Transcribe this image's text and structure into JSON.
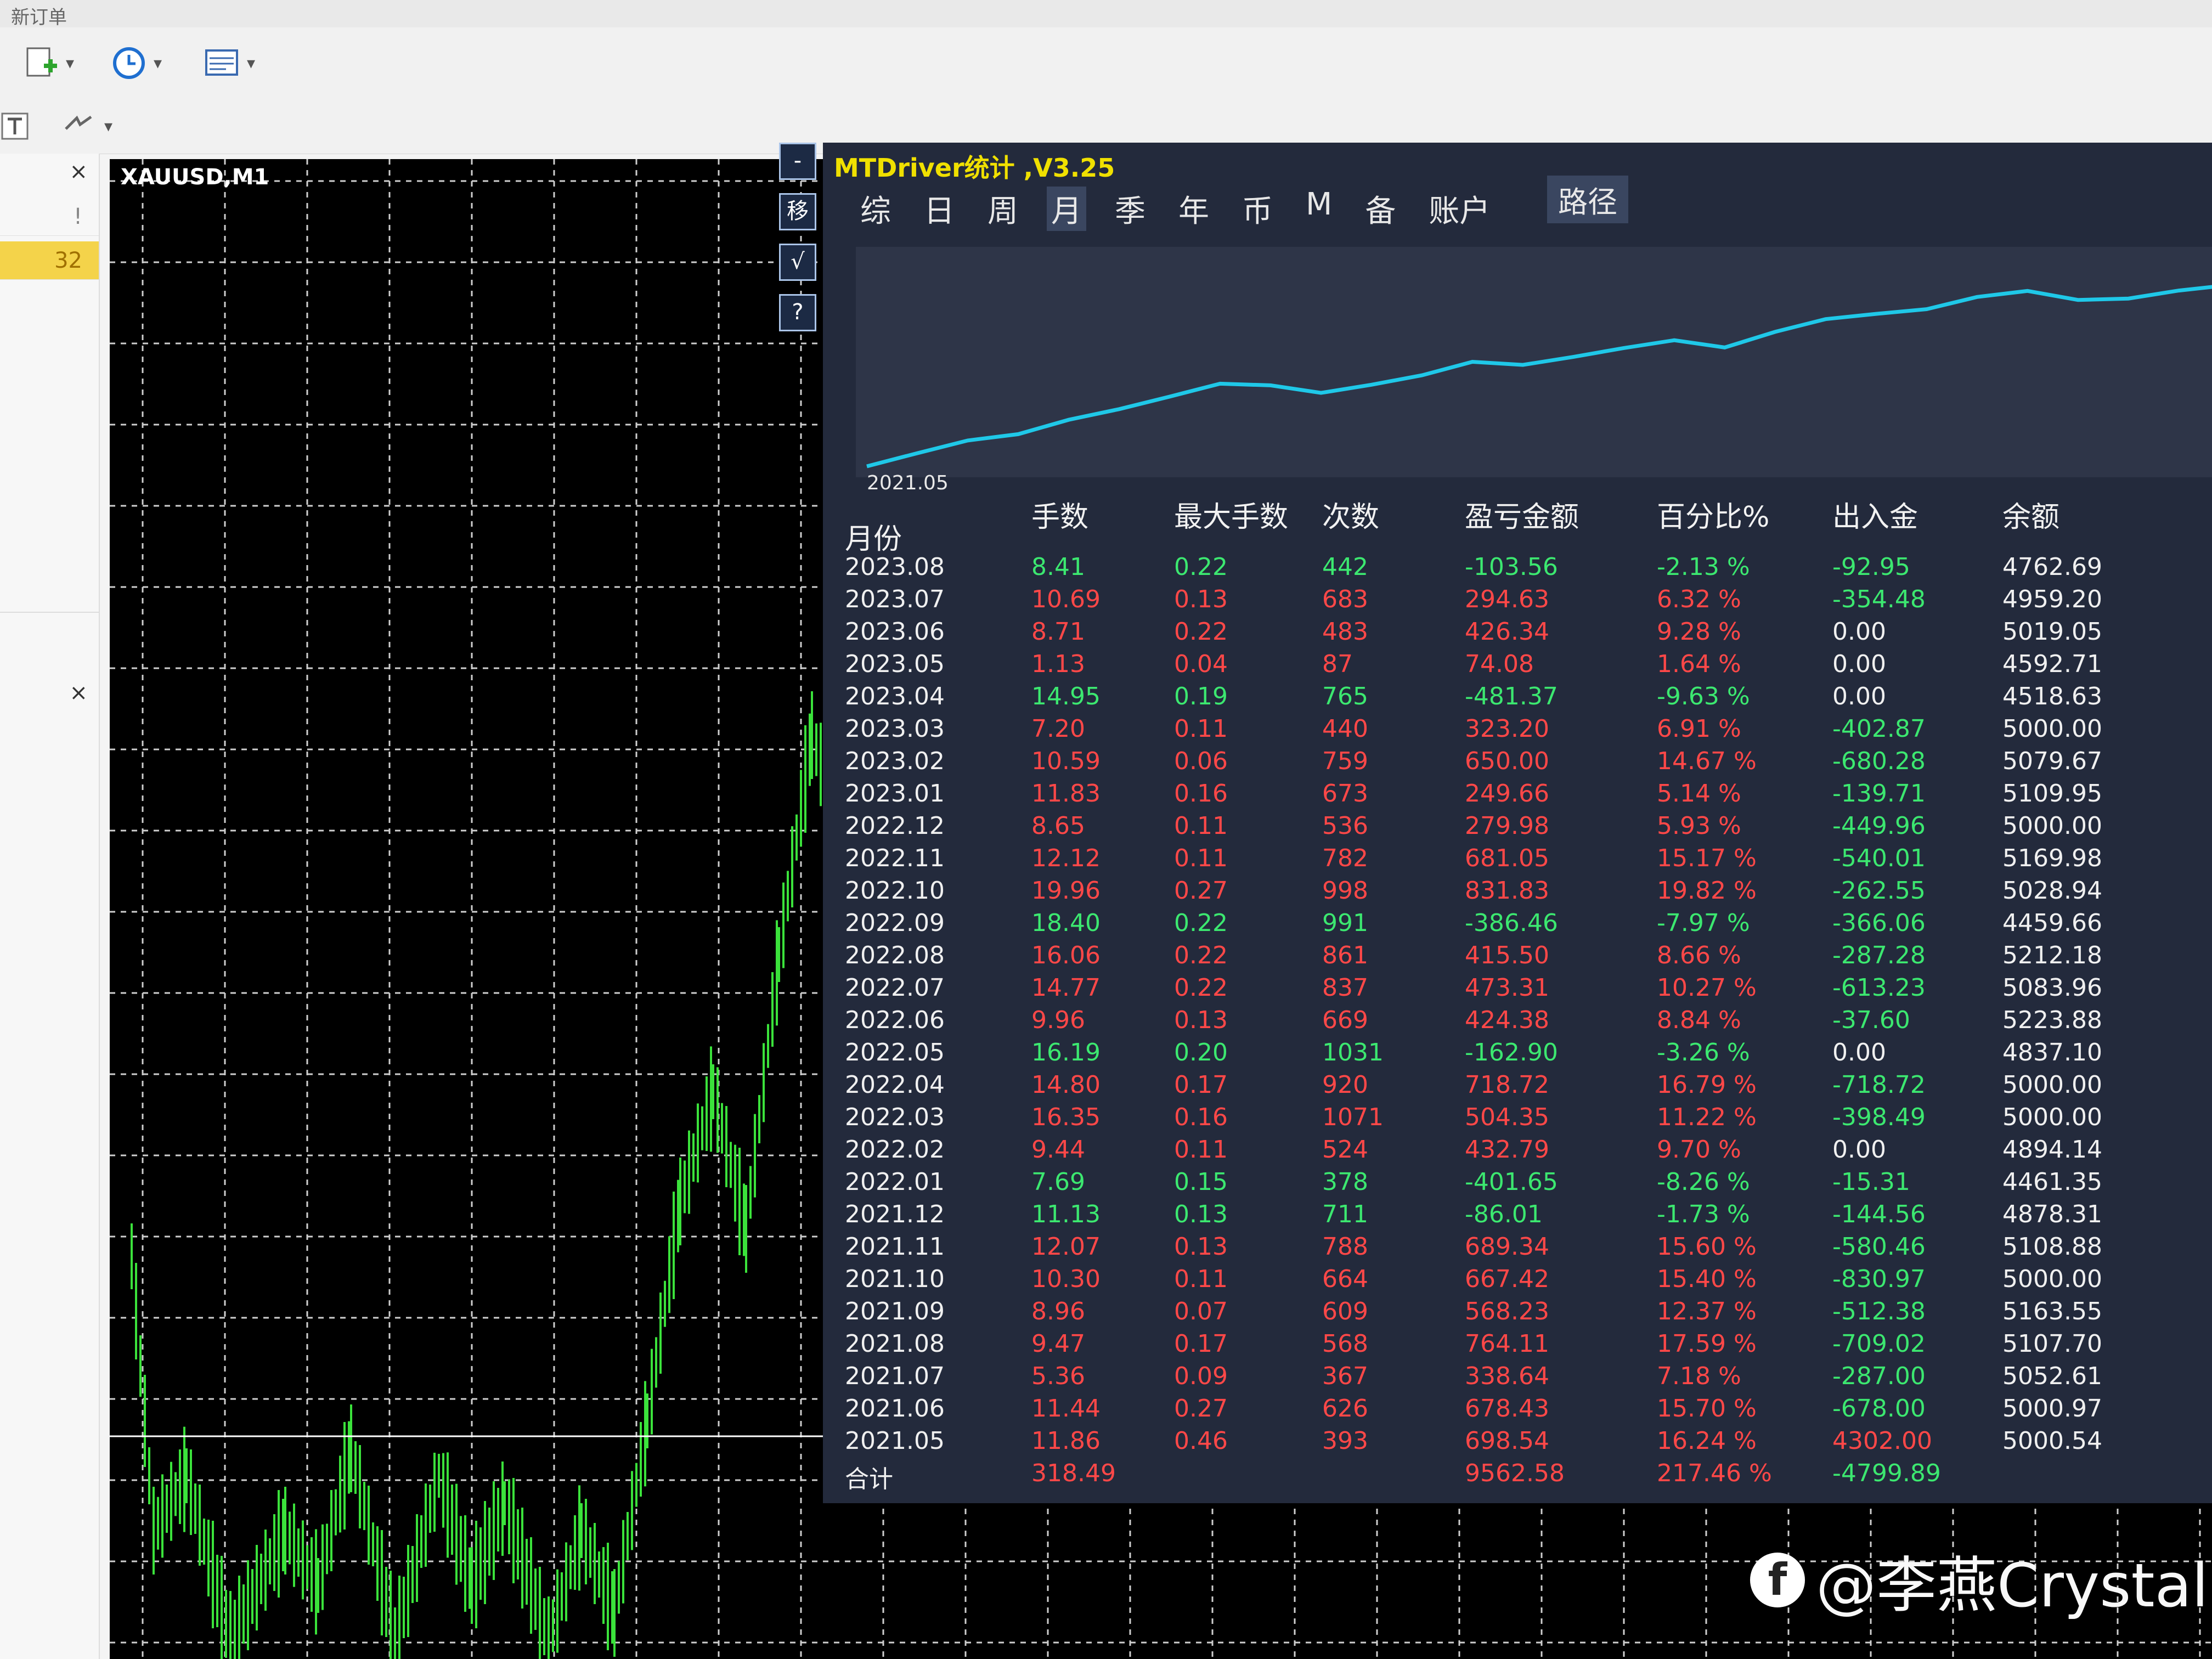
{
  "toolbar": {
    "top_label": "新订单"
  },
  "left_panel": {
    "rows": [
      "!",
      "32"
    ]
  },
  "chart": {
    "symbol_label": "XAUUSD,M1"
  },
  "side_buttons": [
    "-",
    "移",
    "√",
    "?"
  ],
  "panel": {
    "title": "MTDriver统计 ,V3.25",
    "tabs": [
      "综",
      "日",
      "周",
      "月",
      "季",
      "年",
      "币",
      "M",
      "备",
      "账户"
    ],
    "active_tab": "月",
    "path_label": "路径",
    "graph_start_label": "2021.05",
    "columns": {
      "month": "月份",
      "lots": "手数",
      "max_lots": "最大手数",
      "count": "次数",
      "pnl": "盈亏金额",
      "pct": "百分比%",
      "io": "出入金",
      "balance": "余额"
    },
    "rows": [
      {
        "month": "2023.08",
        "lots": "8.41",
        "max_lots": "0.22",
        "count": "442",
        "pnl": "-103.56",
        "pct": "-2.13 %",
        "io": "-92.95",
        "balance": "4762.69"
      },
      {
        "month": "2023.07",
        "lots": "10.69",
        "max_lots": "0.13",
        "count": "683",
        "pnl": "294.63",
        "pct": "6.32 %",
        "io": "-354.48",
        "balance": "4959.20"
      },
      {
        "month": "2023.06",
        "lots": "8.71",
        "max_lots": "0.22",
        "count": "483",
        "pnl": "426.34",
        "pct": "9.28 %",
        "io": "0.00",
        "balance": "5019.05"
      },
      {
        "month": "2023.05",
        "lots": "1.13",
        "max_lots": "0.04",
        "count": "87",
        "pnl": "74.08",
        "pct": "1.64 %",
        "io": "0.00",
        "balance": "4592.71"
      },
      {
        "month": "2023.04",
        "lots": "14.95",
        "max_lots": "0.19",
        "count": "765",
        "pnl": "-481.37",
        "pct": "-9.63 %",
        "io": "0.00",
        "balance": "4518.63"
      },
      {
        "month": "2023.03",
        "lots": "7.20",
        "max_lots": "0.11",
        "count": "440",
        "pnl": "323.20",
        "pct": "6.91 %",
        "io": "-402.87",
        "balance": "5000.00"
      },
      {
        "month": "2023.02",
        "lots": "10.59",
        "max_lots": "0.06",
        "count": "759",
        "pnl": "650.00",
        "pct": "14.67 %",
        "io": "-680.28",
        "balance": "5079.67"
      },
      {
        "month": "2023.01",
        "lots": "11.83",
        "max_lots": "0.16",
        "count": "673",
        "pnl": "249.66",
        "pct": "5.14 %",
        "io": "-139.71",
        "balance": "5109.95"
      },
      {
        "month": "2022.12",
        "lots": "8.65",
        "max_lots": "0.11",
        "count": "536",
        "pnl": "279.98",
        "pct": "5.93 %",
        "io": "-449.96",
        "balance": "5000.00"
      },
      {
        "month": "2022.11",
        "lots": "12.12",
        "max_lots": "0.11",
        "count": "782",
        "pnl": "681.05",
        "pct": "15.17 %",
        "io": "-540.01",
        "balance": "5169.98"
      },
      {
        "month": "2022.10",
        "lots": "19.96",
        "max_lots": "0.27",
        "count": "998",
        "pnl": "831.83",
        "pct": "19.82 %",
        "io": "-262.55",
        "balance": "5028.94"
      },
      {
        "month": "2022.09",
        "lots": "18.40",
        "max_lots": "0.22",
        "count": "991",
        "pnl": "-386.46",
        "pct": "-7.97 %",
        "io": "-366.06",
        "balance": "4459.66"
      },
      {
        "month": "2022.08",
        "lots": "16.06",
        "max_lots": "0.22",
        "count": "861",
        "pnl": "415.50",
        "pct": "8.66 %",
        "io": "-287.28",
        "balance": "5212.18"
      },
      {
        "month": "2022.07",
        "lots": "14.77",
        "max_lots": "0.22",
        "count": "837",
        "pnl": "473.31",
        "pct": "10.27 %",
        "io": "-613.23",
        "balance": "5083.96"
      },
      {
        "month": "2022.06",
        "lots": "9.96",
        "max_lots": "0.13",
        "count": "669",
        "pnl": "424.38",
        "pct": "8.84 %",
        "io": "-37.60",
        "balance": "5223.88"
      },
      {
        "month": "2022.05",
        "lots": "16.19",
        "max_lots": "0.20",
        "count": "1031",
        "pnl": "-162.90",
        "pct": "-3.26 %",
        "io": "0.00",
        "balance": "4837.10"
      },
      {
        "month": "2022.04",
        "lots": "14.80",
        "max_lots": "0.17",
        "count": "920",
        "pnl": "718.72",
        "pct": "16.79 %",
        "io": "-718.72",
        "balance": "5000.00"
      },
      {
        "month": "2022.03",
        "lots": "16.35",
        "max_lots": "0.16",
        "count": "1071",
        "pnl": "504.35",
        "pct": "11.22 %",
        "io": "-398.49",
        "balance": "5000.00"
      },
      {
        "month": "2022.02",
        "lots": "9.44",
        "max_lots": "0.11",
        "count": "524",
        "pnl": "432.79",
        "pct": "9.70 %",
        "io": "0.00",
        "balance": "4894.14"
      },
      {
        "month": "2022.01",
        "lots": "7.69",
        "max_lots": "0.15",
        "count": "378",
        "pnl": "-401.65",
        "pct": "-8.26 %",
        "io": "-15.31",
        "balance": "4461.35"
      },
      {
        "month": "2021.12",
        "lots": "11.13",
        "max_lots": "0.13",
        "count": "711",
        "pnl": "-86.01",
        "pct": "-1.73 %",
        "io": "-144.56",
        "balance": "4878.31"
      },
      {
        "month": "2021.11",
        "lots": "12.07",
        "max_lots": "0.13",
        "count": "788",
        "pnl": "689.34",
        "pct": "15.60 %",
        "io": "-580.46",
        "balance": "5108.88"
      },
      {
        "month": "2021.10",
        "lots": "10.30",
        "max_lots": "0.11",
        "count": "664",
        "pnl": "667.42",
        "pct": "15.40 %",
        "io": "-830.97",
        "balance": "5000.00"
      },
      {
        "month": "2021.09",
        "lots": "8.96",
        "max_lots": "0.07",
        "count": "609",
        "pnl": "568.23",
        "pct": "12.37 %",
        "io": "-512.38",
        "balance": "5163.55"
      },
      {
        "month": "2021.08",
        "lots": "9.47",
        "max_lots": "0.17",
        "count": "568",
        "pnl": "764.11",
        "pct": "17.59 %",
        "io": "-709.02",
        "balance": "5107.70"
      },
      {
        "month": "2021.07",
        "lots": "5.36",
        "max_lots": "0.09",
        "count": "367",
        "pnl": "338.64",
        "pct": "7.18 %",
        "io": "-287.00",
        "balance": "5052.61"
      },
      {
        "month": "2021.06",
        "lots": "11.44",
        "max_lots": "0.27",
        "count": "626",
        "pnl": "678.43",
        "pct": "15.70 %",
        "io": "-678.00",
        "balance": "5000.97"
      },
      {
        "month": "2021.05",
        "lots": "11.86",
        "max_lots": "0.46",
        "count": "393",
        "pnl": "698.54",
        "pct": "16.24 %",
        "io": "4302.00",
        "balance": "5000.54"
      }
    ],
    "total": {
      "label": "合计",
      "lots": "318.49",
      "pnl": "9562.58",
      "pct": "217.46 %",
      "io": "-4799.89"
    }
  },
  "watermark": {
    "text": "@李燕Crystal"
  },
  "colors": {
    "profit": "#ff4848",
    "loss": "#3ce870",
    "equity_line": "#1fc8e8",
    "title": "#f0e000"
  }
}
